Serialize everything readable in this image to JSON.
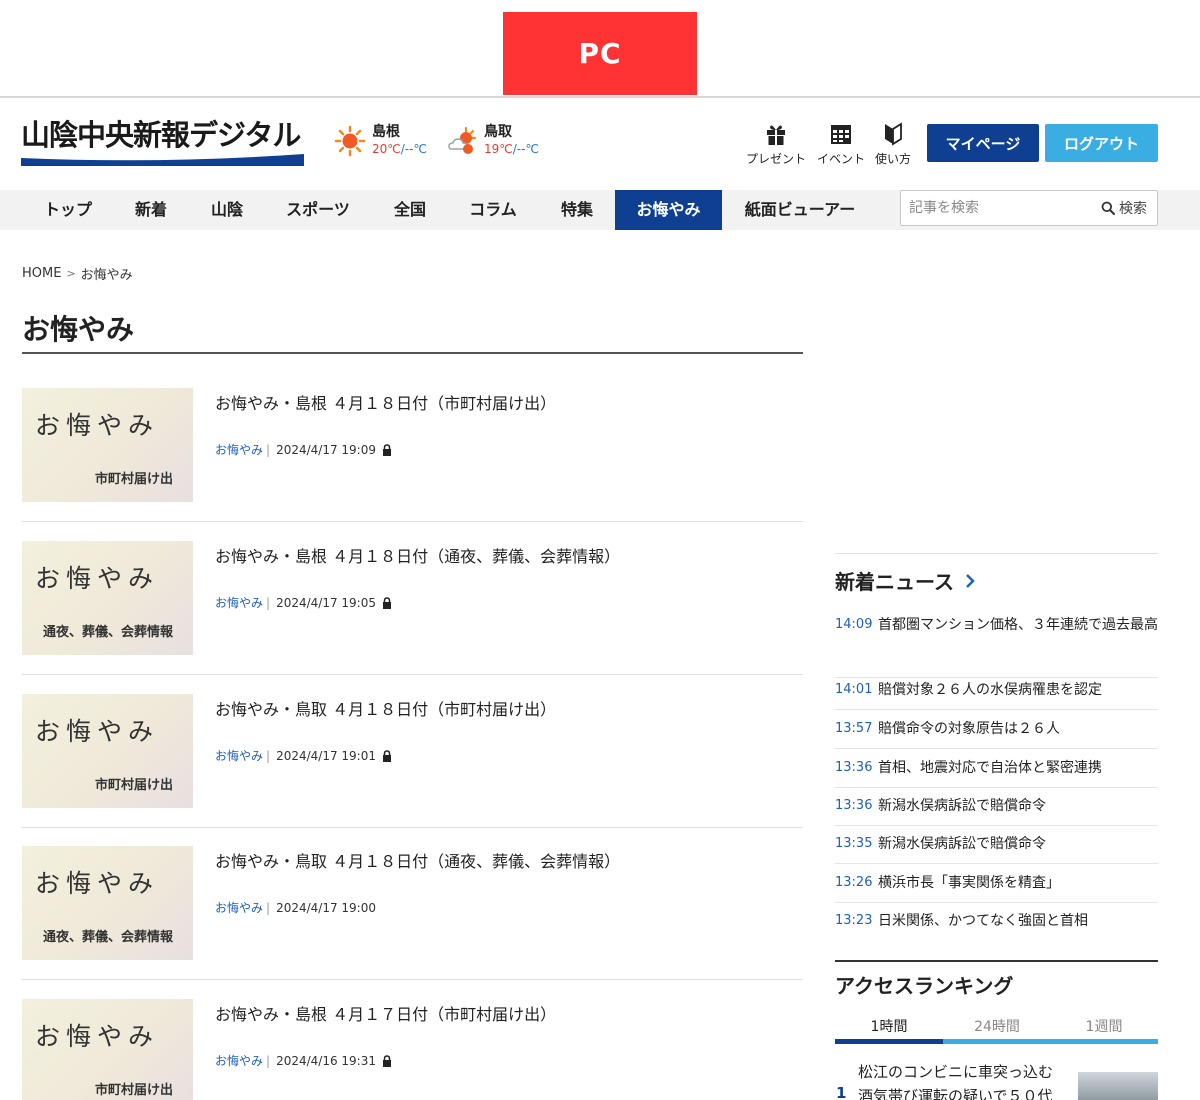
{
  "badge": "PC",
  "header": {
    "logo_text": "山陰中央新報デジタル",
    "weather": [
      {
        "name": "島根",
        "high": "20℃",
        "low": "/--℃"
      },
      {
        "name": "鳥取",
        "high": "19℃",
        "low": "/--℃"
      }
    ],
    "utility": [
      {
        "label": "プレゼント",
        "icon": "gift-icon"
      },
      {
        "label": "イベント",
        "icon": "calendar-icon"
      },
      {
        "label": "使い方",
        "icon": "beginner-mark-icon"
      }
    ],
    "mypage_label": "マイページ",
    "logout_label": "ログアウト"
  },
  "nav": {
    "items": [
      "トップ",
      "新着",
      "山陰",
      "スポーツ",
      "全国",
      "コラム",
      "特集",
      "お悔やみ",
      "紙面ビューアー"
    ],
    "active": "お悔やみ",
    "search_placeholder": "記事を検索",
    "search_button": "検索"
  },
  "breadcrumb": {
    "home": "HOME",
    "current": "お悔やみ"
  },
  "page_title": "お悔やみ",
  "articles": [
    {
      "thumb_main": "お悔やみ",
      "thumb_sub": "市町村届け出",
      "title": "お悔やみ・島根 ４月１８日付（市町村届け出）",
      "category": "お悔やみ",
      "date": "2024/4/17 19:09",
      "locked": true
    },
    {
      "thumb_main": "お悔やみ",
      "thumb_sub": "通夜、葬儀、会葬情報",
      "title": "お悔やみ・島根 ４月１８日付（通夜、葬儀、会葬情報）",
      "category": "お悔やみ",
      "date": "2024/4/17 19:05",
      "locked": true
    },
    {
      "thumb_main": "お悔やみ",
      "thumb_sub": "市町村届け出",
      "title": "お悔やみ・鳥取 ４月１８日付（市町村届け出）",
      "category": "お悔やみ",
      "date": "2024/4/17 19:01",
      "locked": true
    },
    {
      "thumb_main": "お悔やみ",
      "thumb_sub": "通夜、葬儀、会葬情報",
      "title": "お悔やみ・鳥取 ４月１８日付（通夜、葬儀、会葬情報）",
      "category": "お悔やみ",
      "date": "2024/4/17 19:00",
      "locked": false
    },
    {
      "thumb_main": "お悔やみ",
      "thumb_sub": "市町村届け出",
      "title": "お悔やみ・島根 ４月１７日付（市町村届け出）",
      "category": "お悔やみ",
      "date": "2024/4/16 19:31",
      "locked": true
    }
  ],
  "sidebar": {
    "news_title": "新着ニュース",
    "news": [
      {
        "time": "14:09",
        "text": "首都圏マンション価格、３年連続で過去最高"
      },
      {
        "time": "14:01",
        "text": "賠償対象２６人の水俣病罹患を認定"
      },
      {
        "time": "13:57",
        "text": "賠償命令の対象原告は２６人"
      },
      {
        "time": "13:36",
        "text": "首相、地震対応で自治体と緊密連携"
      },
      {
        "time": "13:36",
        "text": "新潟水俣病訴訟で賠償命令"
      },
      {
        "time": "13:35",
        "text": "新潟水俣病訴訟で賠償命令"
      },
      {
        "time": "13:26",
        "text": "横浜市長「事実関係を精査」"
      },
      {
        "time": "13:23",
        "text": "日米関係、かつてなく強固と首相"
      }
    ],
    "ranking_title": "アクセスランキング",
    "ranking_tabs": [
      "1時間",
      "24時間",
      "1週間"
    ],
    "ranking_active_tab": "1時間",
    "ranking_first": {
      "rank": "1",
      "text": "松江のコンビニに車突っ込む　酒気帯び運転の疑いで５０代"
    }
  },
  "colors": {
    "brand_navy": "#0e3f91",
    "accent_cyan": "#3aaee3",
    "badge_red": "#ff3333",
    "link_blue": "#1e5fbf"
  }
}
